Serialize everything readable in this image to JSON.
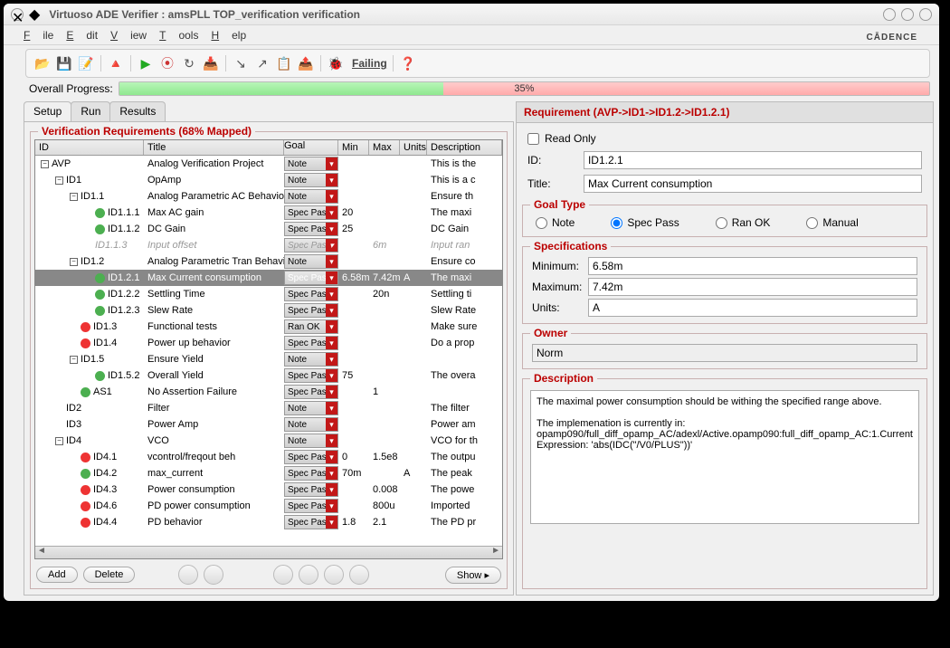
{
  "window": {
    "title": "Virtuoso ADE Verifier : amsPLL TOP_verification verification"
  },
  "menu": {
    "items": [
      "File",
      "Edit",
      "View",
      "Tools",
      "Help"
    ]
  },
  "brand": "cādence",
  "toolbar": {
    "failing": "Failing"
  },
  "progress": {
    "label": "Overall Progress:",
    "percent": 35,
    "text": "35%"
  },
  "tabs": {
    "setup": "Setup",
    "run": "Run",
    "results": "Results"
  },
  "req_panel": {
    "title": "Verification Requirements (68% Mapped)",
    "columns": {
      "id": "ID",
      "title": "Title",
      "goal": "Goal",
      "min": "Min",
      "max": "Max",
      "units": "Units",
      "desc": "Description"
    },
    "rows": [
      {
        "indent": 0,
        "toggle": "-",
        "id": "AVP",
        "title": "Analog Verification Project",
        "goal": "Note",
        "desc": "This is the"
      },
      {
        "indent": 1,
        "toggle": "-",
        "id": "ID1",
        "title": "OpAmp",
        "goal": "Note",
        "desc": "This is a c"
      },
      {
        "indent": 2,
        "toggle": "-",
        "id": "ID1.1",
        "title": "Analog Parametric AC Behavior",
        "goal": "Note",
        "desc": "Ensure th"
      },
      {
        "indent": 3,
        "icon": "g",
        "id": "ID1.1.1",
        "title": "Max AC gain",
        "goal": "Spec Pass",
        "min": "20",
        "desc": "The maxi"
      },
      {
        "indent": 3,
        "icon": "g",
        "id": "ID1.1.2",
        "title": "DC Gain",
        "goal": "Spec Pass",
        "min": "25",
        "desc": "DC Gain"
      },
      {
        "indent": 3,
        "muted": true,
        "id": "ID1.1.3",
        "title": "Input offset",
        "goal": "Spec Pass",
        "max": "6m",
        "desc": "Input ran"
      },
      {
        "indent": 2,
        "toggle": "-",
        "id": "ID1.2",
        "title": "Analog Parametric Tran Behavior",
        "goal": "Note",
        "desc": "Ensure co"
      },
      {
        "indent": 3,
        "icon": "g",
        "sel": true,
        "id": "ID1.2.1",
        "title": "Max Current consumption",
        "goal": "Spec Pass",
        "min": "6.58m",
        "max": "7.42m",
        "units": "A",
        "desc": "The maxi"
      },
      {
        "indent": 3,
        "icon": "g",
        "id": "ID1.2.2",
        "title": "Settling Time",
        "goal": "Spec Pass",
        "max": "20n",
        "desc": "Settling ti"
      },
      {
        "indent": 3,
        "icon": "g",
        "id": "ID1.2.3",
        "title": "Slew Rate",
        "goal": "Spec Pass",
        "desc": "Slew Rate"
      },
      {
        "indent": 2,
        "icon": "r",
        "id": "ID1.3",
        "title": "Functional tests",
        "goal": "Ran OK",
        "desc": "Make sure"
      },
      {
        "indent": 2,
        "icon": "r",
        "id": "ID1.4",
        "title": "Power up behavior",
        "goal": "Spec Pass",
        "desc": "Do a prop"
      },
      {
        "indent": 2,
        "toggle": "-",
        "id": "ID1.5",
        "title": "Ensure Yield",
        "goal": "Note"
      },
      {
        "indent": 3,
        "icon": "g",
        "id": "ID1.5.2",
        "title": "Overall Yield",
        "goal": "Spec Pass",
        "min": "75",
        "desc": "The overa"
      },
      {
        "indent": 2,
        "icon": "g",
        "id": "AS1",
        "title": "No Assertion Failure",
        "goal": "Spec Pass",
        "max": "1"
      },
      {
        "indent": 1,
        "id": "ID2",
        "title": "Filter",
        "goal": "Note",
        "desc": "The filter"
      },
      {
        "indent": 1,
        "id": "ID3",
        "title": "Power Amp",
        "goal": "Note",
        "desc": "Power am"
      },
      {
        "indent": 1,
        "toggle": "-",
        "id": "ID4",
        "title": "VCO",
        "goal": "Note",
        "desc": "VCO for th"
      },
      {
        "indent": 2,
        "icon": "r",
        "id": "ID4.1",
        "title": "vcontrol/freqout beh",
        "goal": "Spec Pass",
        "min": "0",
        "max": "1.5e8",
        "desc": "The outpu"
      },
      {
        "indent": 2,
        "icon": "g",
        "id": "ID4.2",
        "title": "max_current",
        "goal": "Spec Pass",
        "min": "70m",
        "units": "A",
        "desc": "The peak"
      },
      {
        "indent": 2,
        "icon": "r",
        "id": "ID4.3",
        "title": "Power consumption",
        "goal": "Spec Pass",
        "max": "0.008",
        "desc": "The powe"
      },
      {
        "indent": 2,
        "icon": "r",
        "id": "ID4.6",
        "title": "PD power consumption",
        "goal": "Spec Pass",
        "max": "800u",
        "desc": "Imported"
      },
      {
        "indent": 2,
        "icon": "r",
        "id": "ID4.4",
        "title": "PD behavior",
        "goal": "Spec Pass",
        "min": "1.8",
        "max": "2.1",
        "desc": "The PD pr"
      }
    ],
    "buttons": {
      "add": "Add",
      "delete": "Delete",
      "show": "Show"
    }
  },
  "detail": {
    "header": "Requirement (AVP->ID1->ID1.2->ID1.2.1)",
    "read_only": "Read Only",
    "id_label": "ID:",
    "id_value": "ID1.2.1",
    "title_label": "Title:",
    "title_value": "Max Current consumption",
    "goal_type": {
      "legend": "Goal Type",
      "opts": {
        "note": "Note",
        "spec": "Spec Pass",
        "ran": "Ran OK",
        "manual": "Manual"
      },
      "selected": "spec"
    },
    "specs": {
      "legend": "Specifications",
      "min_label": "Minimum:",
      "min": "6.58m",
      "max_label": "Maximum:",
      "max": "7.42m",
      "units_label": "Units:",
      "units": "A"
    },
    "owner": {
      "legend": "Owner",
      "value": "Norm"
    },
    "description": {
      "legend": "Description",
      "text": "The maximal power consumption should be withing the specified range above.\n\nThe implemenation is currently in:\nopamp090/full_diff_opamp_AC/adexl/Active.opamp090:full_diff_opamp_AC:1.Current\nExpression: 'abs(IDC(\"/V0/PLUS\"))'"
    }
  }
}
